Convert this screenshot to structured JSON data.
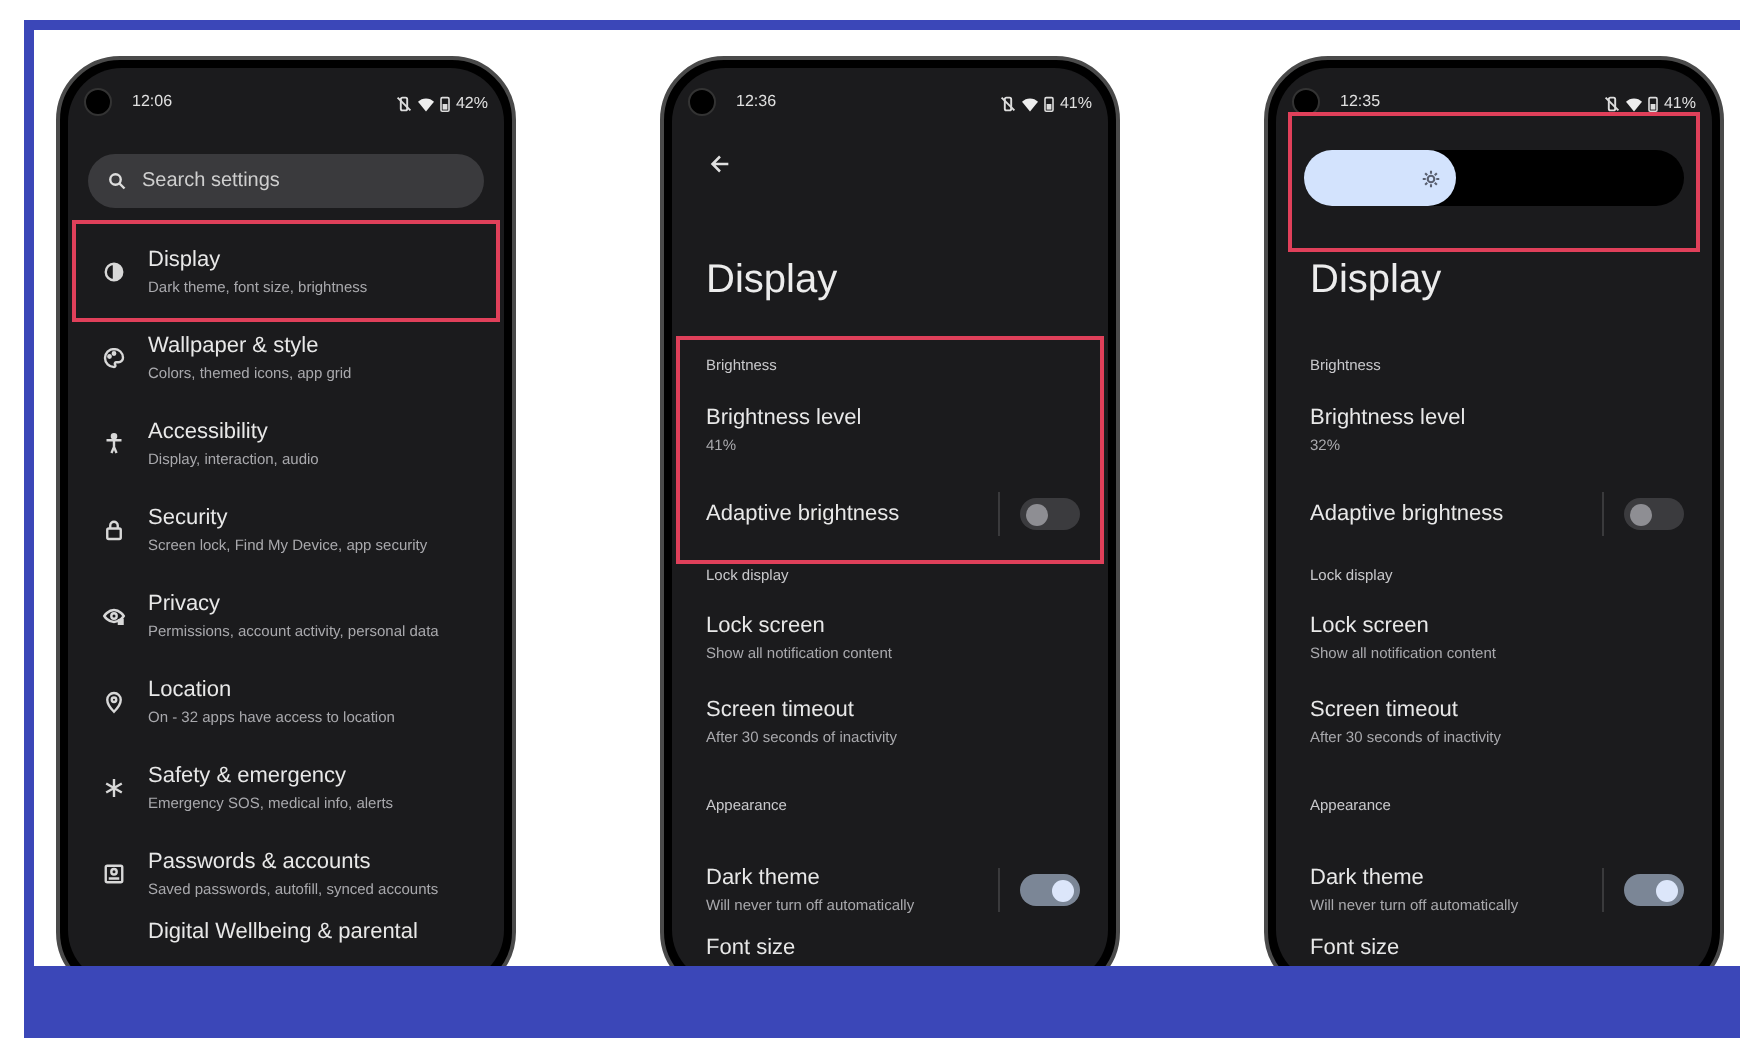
{
  "phones": [
    {
      "kind": "settings",
      "status": {
        "time": "12:06",
        "battery": "42%"
      },
      "search": {
        "placeholder": "Search settings"
      },
      "items": [
        {
          "title": "Display",
          "subtitle": "Dark theme, font size, brightness",
          "highlighted": true
        },
        {
          "title": "Wallpaper & style",
          "subtitle": "Colors, themed icons, app grid",
          "highlighted": false
        },
        {
          "title": "Accessibility",
          "subtitle": "Display, interaction, audio",
          "highlighted": false
        },
        {
          "title": "Security",
          "subtitle": "Screen lock, Find My Device, app security",
          "highlighted": false
        },
        {
          "title": "Privacy",
          "subtitle": "Permissions, account activity, personal data",
          "highlighted": false
        },
        {
          "title": "Location",
          "subtitle": "On - 32 apps have access to location",
          "highlighted": false
        },
        {
          "title": "Safety & emergency",
          "subtitle": "Emergency SOS, medical info, alerts",
          "highlighted": false
        },
        {
          "title": "Passwords & accounts",
          "subtitle": "Saved passwords, autofill, synced accounts",
          "highlighted": false
        },
        {
          "title": "Digital Wellbeing & parental"
        }
      ]
    },
    {
      "kind": "display",
      "status": {
        "time": "12:36",
        "battery": "41%"
      },
      "top": {
        "kind": "back"
      },
      "title": "Display",
      "sections": [
        {
          "header": "Brightness",
          "highlighted": true,
          "items": [
            {
              "title": "Brightness level",
              "subtitle": "41%"
            },
            {
              "title": "Adaptive brightness",
              "kind": "toggle",
              "on": false
            }
          ]
        },
        {
          "header": "Lock display",
          "highlighted": false,
          "items": [
            {
              "title": "Lock screen",
              "subtitle": "Show all notification content"
            },
            {
              "title": "Screen timeout",
              "subtitle": "After 30 seconds of inactivity"
            }
          ]
        },
        {
          "header": "Appearance",
          "highlighted": false,
          "items": [
            {
              "title": "Dark theme",
              "subtitle": "Will never turn off automatically",
              "kind": "toggle",
              "on": true
            },
            {
              "title": "Font size"
            }
          ]
        }
      ]
    },
    {
      "kind": "display",
      "status": {
        "time": "12:35",
        "battery": "41%"
      },
      "top": {
        "kind": "brightness_slider",
        "level": 0.4,
        "highlighted": true
      },
      "title": "Display",
      "sections": [
        {
          "header": "Brightness",
          "highlighted": false,
          "items": [
            {
              "title": "Brightness level",
              "subtitle": "32%"
            },
            {
              "title": "Adaptive brightness",
              "kind": "toggle",
              "on": false
            }
          ]
        },
        {
          "header": "Lock display",
          "highlighted": false,
          "items": [
            {
              "title": "Lock screen",
              "subtitle": "Show all notification content"
            },
            {
              "title": "Screen timeout",
              "subtitle": "After 30 seconds of inactivity"
            }
          ]
        },
        {
          "header": "Appearance",
          "highlighted": false,
          "items": [
            {
              "title": "Dark theme",
              "subtitle": "Will never turn off automatically",
              "kind": "toggle",
              "on": true
            },
            {
              "title": "Font size"
            }
          ]
        }
      ]
    }
  ]
}
